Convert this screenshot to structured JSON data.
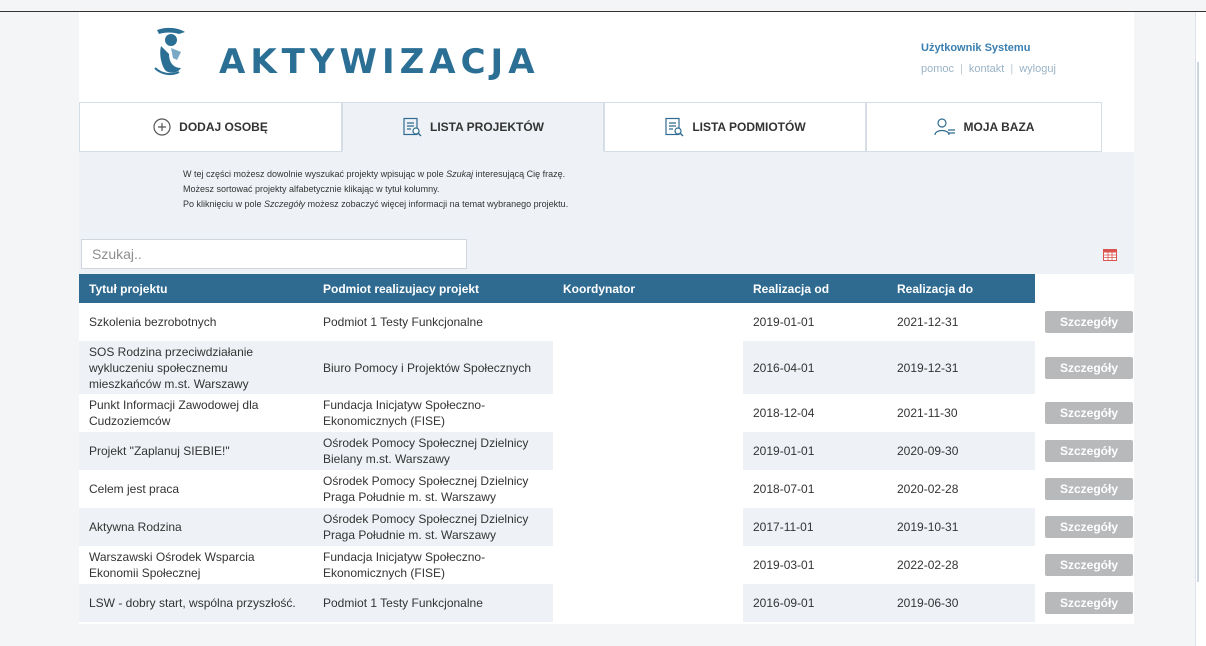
{
  "header": {
    "brand": "AKTYWIZACJA",
    "logo_icon": "logo-figure-icon",
    "user_name": "Użytkownik Systemu",
    "links": [
      "pomoc",
      "kontakt",
      "wyloguj"
    ]
  },
  "tabs": [
    {
      "label": "DODAJ OSOBĘ",
      "icon": "plus-circle-icon",
      "active": false
    },
    {
      "label": "LISTA PROJEKTÓW",
      "icon": "list-search-icon",
      "active": true
    },
    {
      "label": "LISTA PODMIOTÓW",
      "icon": "list-search-icon",
      "active": false
    },
    {
      "label": "MOJA BAZA",
      "icon": "user-list-icon",
      "active": false
    }
  ],
  "info": {
    "line1_a": "W tej części możesz dowolnie wyszukać projekty wpisując w pole ",
    "line1_em": "Szukaj",
    "line1_b": " interesującą Cię frazę.",
    "line2": "Możesz sortować projekty alfabetycznie klikając w tytuł kolumny.",
    "line3_a": "Po kliknięciu w pole ",
    "line3_em": "Szczegóły",
    "line3_b": " możesz zobaczyć więcej informacji na temat wybranego projektu."
  },
  "search": {
    "placeholder": "Szukaj.."
  },
  "export_icon": "spreadsheet-export-icon",
  "table": {
    "headers": [
      "Tytuł projektu",
      "Podmiot realizujacy projekt",
      "Koordynator",
      "Realizacja od",
      "Realizacja do",
      ""
    ],
    "button_label": "Szczegóły",
    "rows": [
      {
        "title": "Szkolenia bezrobotnych",
        "entity": "Podmiot 1 Testy Funkcjonalne",
        "coordinator": "",
        "from": "2019-01-01",
        "to": "2021-12-31"
      },
      {
        "title": "SOS Rodzina przeciwdziałanie wykluczeniu społecznemu mieszkańców m.st. Warszawy",
        "entity": "Biuro Pomocy i Projektów Społecznych",
        "coordinator": "",
        "from": "2016-04-01",
        "to": "2019-12-31"
      },
      {
        "title": "Punkt Informacji Zawodowej dla Cudzoziemców",
        "entity": "Fundacja Inicjatyw Społeczno-Ekonomicznych (FISE)",
        "coordinator": "",
        "from": "2018-12-04",
        "to": "2021-11-30"
      },
      {
        "title": "Projekt \"Zaplanuj SIEBIE!\"",
        "entity": "Ośrodek Pomocy Społecznej Dzielnicy Bielany m.st. Warszawy",
        "coordinator": "",
        "from": "2019-01-01",
        "to": "2020-09-30"
      },
      {
        "title": "Celem jest praca",
        "entity": "Ośrodek Pomocy Społecznej Dzielnicy Praga Południe m. st. Warszawy",
        "coordinator": "",
        "from": "2018-07-01",
        "to": "2020-02-28"
      },
      {
        "title": "Aktywna Rodzina",
        "entity": "Ośrodek Pomocy Społecznej Dzielnicy Praga Południe m. st. Warszawy",
        "coordinator": "",
        "from": "2017-11-01",
        "to": "2019-10-31"
      },
      {
        "title": "Warszawski Ośrodek Wsparcia Ekonomii Społecznej",
        "entity": "Fundacja Inicjatyw Społeczno-Ekonomicznych (FISE)",
        "coordinator": "",
        "from": "2019-03-01",
        "to": "2022-02-28"
      },
      {
        "title": "LSW - dobry start, wspólna przyszłość.",
        "entity": "Podmiot 1 Testy Funkcjonalne",
        "coordinator": "",
        "from": "2016-09-01",
        "to": "2019-06-30"
      }
    ]
  },
  "colors": {
    "accent": "#2f6b91",
    "brand": "#2b6f95",
    "panel": "#eef2f6",
    "button": "#b7b9bb"
  }
}
